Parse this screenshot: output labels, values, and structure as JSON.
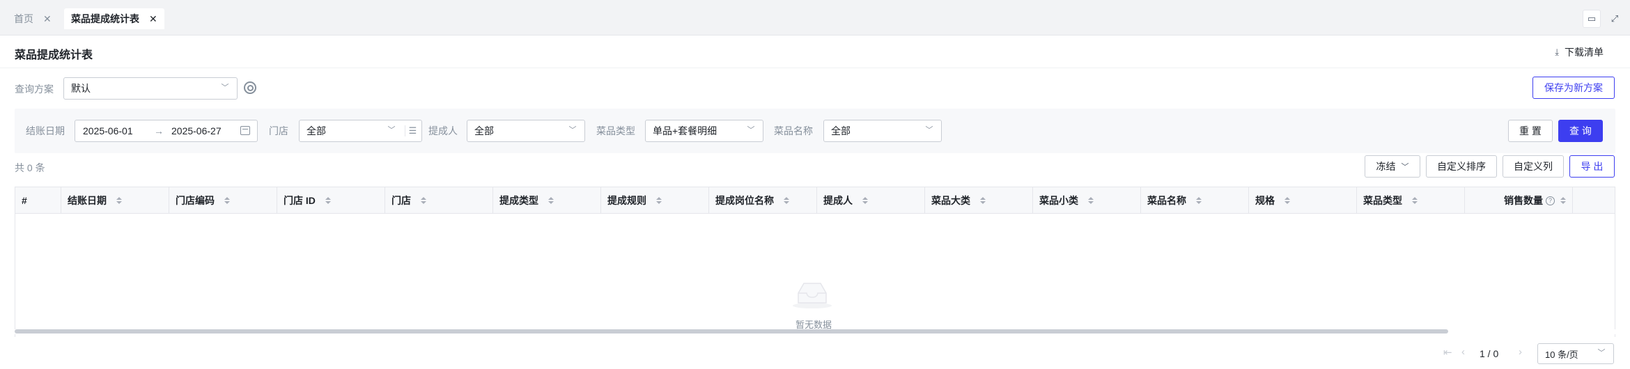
{
  "tabs": [
    {
      "label": "首页",
      "active": false
    },
    {
      "label": "菜品提成统计表",
      "active": true
    }
  ],
  "page": {
    "title": "菜品提成统计表",
    "download_label": "下载清单"
  },
  "scheme": {
    "label": "查询方案",
    "value": "默认",
    "save_label": "保存为新方案"
  },
  "filters": {
    "date_label": "结账日期",
    "date_start": "2025-06-01",
    "date_sep": "→",
    "date_end": "2025-06-27",
    "store_label": "门店",
    "store_value": "全部",
    "person_label": "提成人",
    "person_value": "全部",
    "dish_type_label": "菜品类型",
    "dish_type_value": "单品+套餐明细",
    "dish_name_label": "菜品名称",
    "dish_name_value": "全部",
    "reset_label": "重 置",
    "query_label": "查 询"
  },
  "toolbar": {
    "total": "共 0 条",
    "freeze_label": "冻结",
    "sort_label": "自定义排序",
    "columns_label": "自定义列",
    "export_label": "导 出"
  },
  "table": {
    "columns": [
      "#",
      "结账日期",
      "门店编码",
      "门店 ID",
      "门店",
      "提成类型",
      "提成规则",
      "提成岗位名称",
      "提成人",
      "菜品大类",
      "菜品小类",
      "菜品名称",
      "规格",
      "菜品类型",
      "销售数量"
    ],
    "rows": [],
    "empty_text": "暂无数据"
  },
  "pagination": {
    "page_text": "1  /  0",
    "page_size": "10 条/页"
  },
  "icons": {
    "close": "close-icon",
    "download": "download-icon",
    "settings": "settings-icon",
    "calendar": "calendar-icon",
    "chevron": "chevron-down-icon",
    "empty": "empty-inbox-icon"
  },
  "colors": {
    "primary": "#3d3ef0",
    "border": "#c9cdd4",
    "muted_text": "#86909c"
  }
}
